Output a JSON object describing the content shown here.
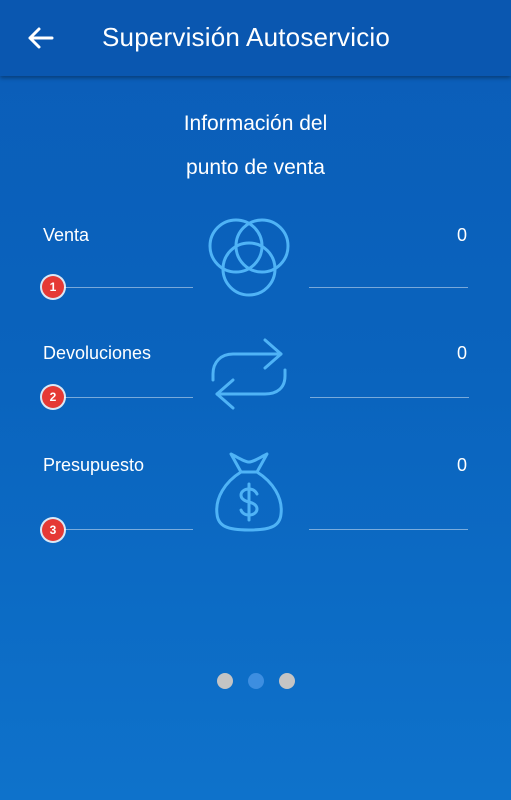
{
  "header": {
    "title": "Supervisión Autoservicio",
    "back_icon": "arrow-left-icon"
  },
  "subtitle": {
    "line1": "Información del",
    "line2": "punto de venta"
  },
  "rows": [
    {
      "label": "Venta",
      "value": "0",
      "badge": "1",
      "icon": "venn-circles-icon"
    },
    {
      "label": "Devoluciones",
      "value": "0",
      "badge": "2",
      "icon": "repeat-arrows-icon"
    },
    {
      "label": "Presupuesto",
      "value": "0",
      "badge": "3",
      "icon": "money-bag-icon"
    }
  ],
  "pager": {
    "pages": 3,
    "active_index": 1
  },
  "colors": {
    "background": "#0b5db8",
    "appbar": "#0a57b0",
    "icon_stroke": "#4fb3f6",
    "badge": "#e53935",
    "dot_inactive": "#c4c4c4",
    "dot_active": "#3d8ee0"
  }
}
